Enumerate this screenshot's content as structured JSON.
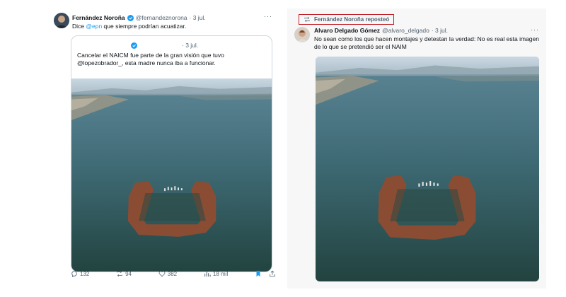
{
  "left_tweet": {
    "author_name": "Fernández Noroña",
    "handle": "@fernandeznorona",
    "time": "· 3 jul.",
    "text_before": "Dice ",
    "mention": "@epn",
    "text_after": " que siempre podrían acuatizar.",
    "more": "···",
    "quote": {
      "time": "· 3 jul.",
      "text": "Cancelar el NAICM fue parte de la gran visión que tuvo @lopezobrador_, esta madre nunca iba a funcionar."
    },
    "actions": {
      "replies": "132",
      "reposts": "94",
      "likes": "382",
      "views": "18 mil"
    }
  },
  "right_tweet": {
    "repost_label": "Fernández Noroña reposteó",
    "author_name": "Alvaro Delgado Gómez",
    "handle": "@alvaro_delgado",
    "time": "· 3 jul.",
    "text": "No sean como los que hacen montajes y detestan la verdad: No es real esta imagen de lo que se pretendió ser el NAIM",
    "more": "···"
  },
  "colors": {
    "accent": "#1d9bf0",
    "highlight_border": "#c0202a",
    "bookmark": "#1d9bf0"
  },
  "icons": [
    "verified-badge-icon",
    "reply-icon",
    "repost-icon",
    "like-icon",
    "views-icon",
    "bookmark-icon",
    "share-icon",
    "more-icon"
  ]
}
